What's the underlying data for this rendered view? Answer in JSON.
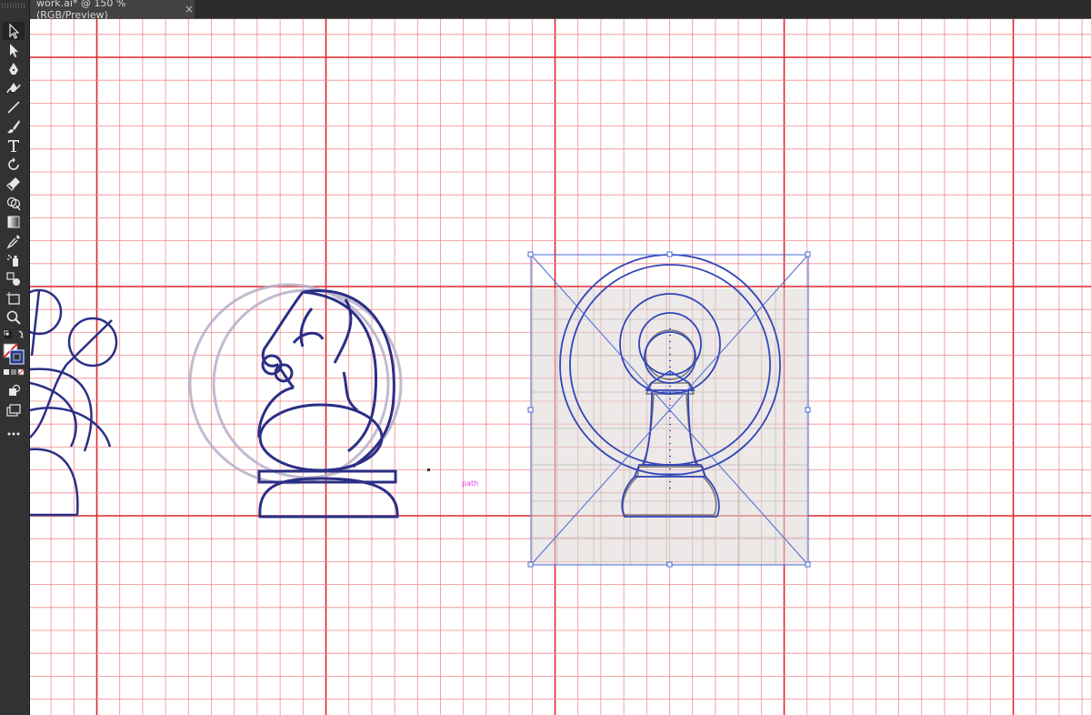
{
  "document_tab": {
    "title": "work.ai* @ 150 % (RGB/Preview)",
    "close_glyph": "×"
  },
  "tools": [
    {
      "name": "selection-tool",
      "icon": "arrow-icon",
      "active": true
    },
    {
      "name": "direct-selection-tool",
      "icon": "white-arrow-icon"
    },
    {
      "name": "pen-tool",
      "icon": "pen-icon"
    },
    {
      "name": "curvature-tool",
      "icon": "curvature-icon"
    },
    {
      "name": "line-segment-tool",
      "icon": "line-icon"
    },
    {
      "name": "paintbrush-tool",
      "icon": "brush-icon"
    },
    {
      "name": "type-tool",
      "icon": "type-icon"
    },
    {
      "name": "rotate-tool",
      "icon": "rotate-icon"
    },
    {
      "name": "eraser-tool",
      "icon": "eraser-icon"
    },
    {
      "name": "shape-builder-tool",
      "icon": "shape-builder-icon"
    },
    {
      "name": "gradient-tool",
      "icon": "gradient-icon"
    },
    {
      "name": "eyedropper-tool",
      "icon": "eyedropper-icon"
    },
    {
      "name": "symbol-sprayer-tool",
      "icon": "sprayer-icon"
    },
    {
      "name": "blend-tool",
      "icon": "blend-icon"
    },
    {
      "name": "artboard-tool",
      "icon": "artboard-icon"
    },
    {
      "name": "zoom-tool",
      "icon": "zoom-icon"
    },
    {
      "name": "fill-stroke-swatch",
      "icon": "fill-stroke-icon"
    },
    {
      "name": "color-mode-buttons",
      "icon": "color-mode-icon"
    },
    {
      "name": "draw-mode-button",
      "icon": "draw-mode-icon"
    },
    {
      "name": "screen-mode-button",
      "icon": "screen-mode-icon"
    },
    {
      "name": "edit-toolbar-button",
      "icon": "more-icon"
    }
  ],
  "canvas": {
    "smart_guide_label": "path",
    "colors": {
      "grid_major": "#e0262e",
      "grid_minor": "#f08a8e",
      "artwork_stroke": "#2b2f85",
      "selection": "#4a6ad8",
      "smart_guide": "#e040e0"
    }
  }
}
